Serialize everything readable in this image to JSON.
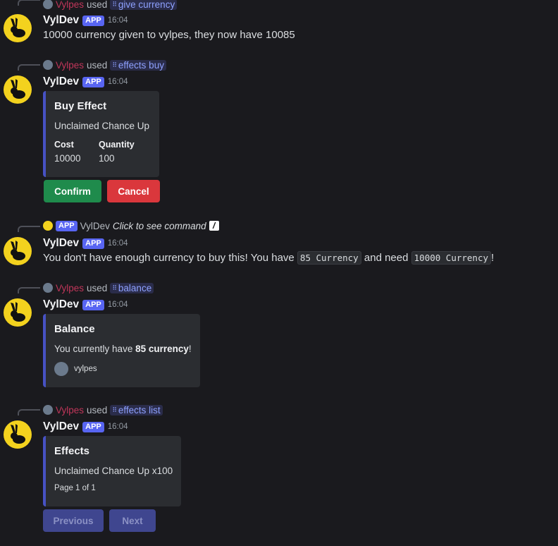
{
  "messages": [
    {
      "reply": {
        "user": "Vylpes",
        "verb": "used",
        "command": "give currency"
      },
      "bot_name": "VylDev",
      "app_tag": "APP",
      "time": "16:04",
      "content": "10000 currency given to vylpes, they now have 10085"
    },
    {
      "reply": {
        "user": "Vylpes",
        "verb": "used",
        "command": "effects buy"
      },
      "bot_name": "VylDev",
      "app_tag": "APP",
      "time": "16:04",
      "embed": {
        "title": "Buy Effect",
        "description": "Unclaimed Chance Up",
        "fields": [
          {
            "name": "Cost",
            "value": "10000"
          },
          {
            "name": "Quantity",
            "value": "100"
          }
        ]
      },
      "buttons": {
        "confirm": "Confirm",
        "cancel": "Cancel"
      }
    },
    {
      "reply": {
        "app_tag": "APP",
        "user": "VylDev",
        "prompt": "Click to see command"
      },
      "bot_name": "VylDev",
      "app_tag": "APP",
      "time": "16:04",
      "content_parts": {
        "before": "You don't have enough currency to buy this! You have",
        "code1": "85 Currency",
        "middle": "and need",
        "code2": "10000 Currency",
        "after": "!"
      }
    },
    {
      "reply": {
        "user": "Vylpes",
        "verb": "used",
        "command": "balance"
      },
      "bot_name": "VylDev",
      "app_tag": "APP",
      "time": "16:04",
      "embed": {
        "title": "Balance",
        "desc_before": "You currently have",
        "desc_bold": "85 currency",
        "desc_after": "!",
        "footer_user": "vylpes"
      }
    },
    {
      "reply": {
        "user": "Vylpes",
        "verb": "used",
        "command": "effects list"
      },
      "bot_name": "VylDev",
      "app_tag": "APP",
      "time": "16:04",
      "embed": {
        "title": "Effects",
        "description": "Unclaimed Chance Up x100",
        "footer": "Page 1 of 1"
      },
      "buttons": {
        "previous": "Previous",
        "next": "Next"
      }
    }
  ],
  "colors": {
    "accent": "#4752c4",
    "background": "#1a1a1e",
    "app_tag": "#5865f2",
    "green": "#1f8b4c",
    "red": "#da373c"
  },
  "icons": {
    "avatar": "rabbit-icon",
    "command": "slash-command-icon"
  }
}
